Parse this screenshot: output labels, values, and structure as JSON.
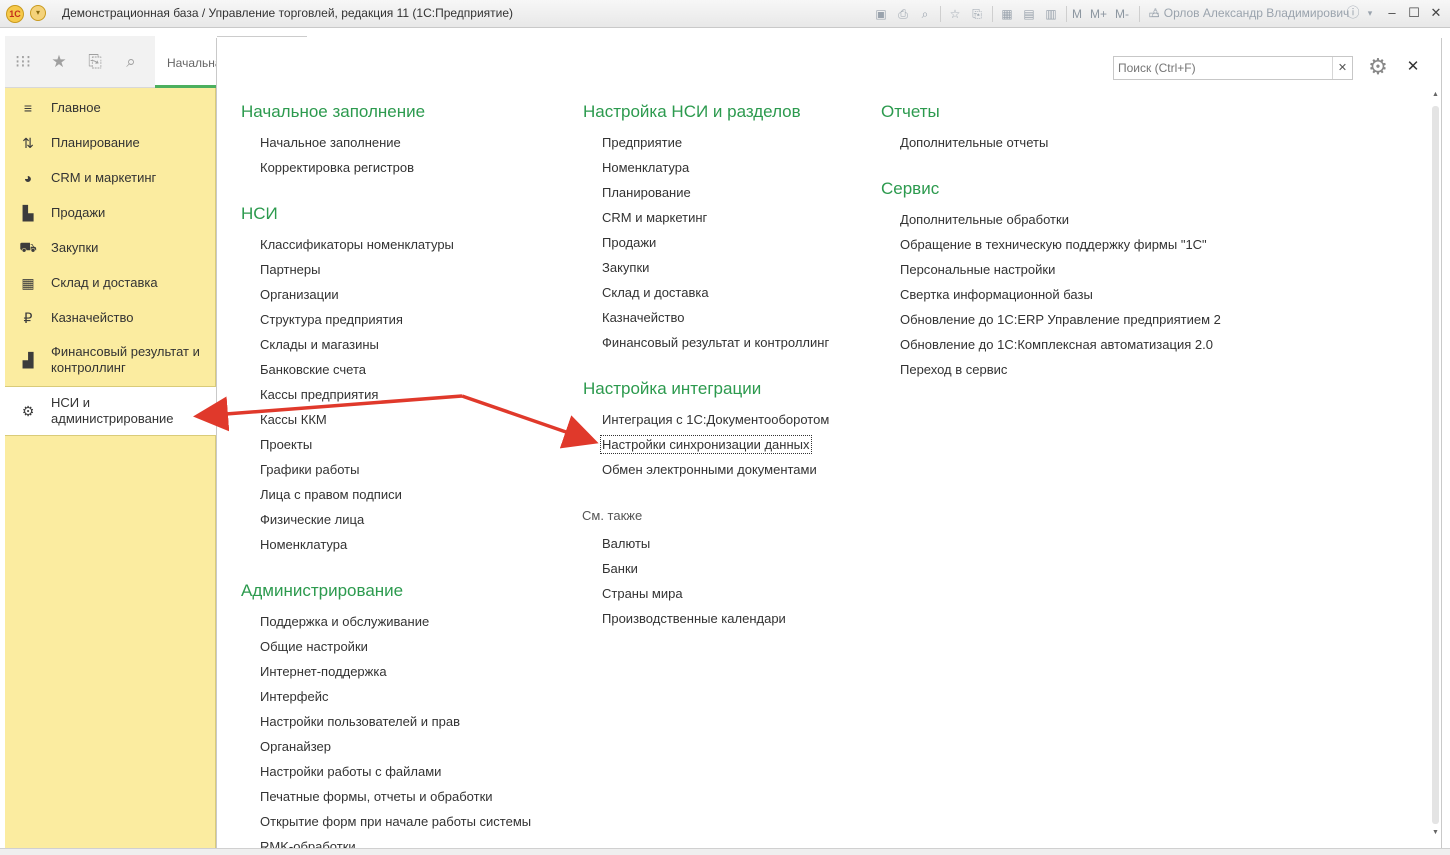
{
  "window": {
    "title": "Демонстрационная база / Управление торговлей, редакция 11  (1С:Предприятие)",
    "logo_text": "1С",
    "user": "Орлов Александр Владимирович",
    "toolbar_m": "M",
    "toolbar_mplus": "M+",
    "toolbar_mminus": "M-"
  },
  "tabs": {
    "start": "Начальная страница"
  },
  "sidebar": {
    "items": [
      {
        "label": "Главное",
        "icon": "menu-icon"
      },
      {
        "label": "Планирование",
        "icon": "planning-icon"
      },
      {
        "label": "CRM и маркетинг",
        "icon": "pie-chart-icon"
      },
      {
        "label": "Продажи",
        "icon": "shopping-bag-icon"
      },
      {
        "label": "Закупки",
        "icon": "cart-icon"
      },
      {
        "label": "Склад и доставка",
        "icon": "warehouse-icon"
      },
      {
        "label": "Казначейство",
        "icon": "ruble-icon"
      },
      {
        "label": "Финансовый результат и контроллинг",
        "icon": "bar-chart-icon"
      },
      {
        "label": "НСИ и администрирование",
        "icon": "gear-icon"
      }
    ]
  },
  "search": {
    "placeholder": "Поиск (Ctrl+F)"
  },
  "col1": {
    "groups": [
      {
        "title": "Начальное заполнение",
        "links": [
          "Начальное заполнение",
          "Корректировка регистров"
        ]
      },
      {
        "title": "НСИ",
        "links": [
          "Классификаторы номенклатуры",
          "Партнеры",
          "Организации",
          "Структура предприятия",
          "Склады и магазины",
          "Банковские счета",
          "Кассы предприятия",
          "Кассы ККМ",
          "Проекты",
          "Графики работы",
          "Лица с правом подписи",
          "Физические лица",
          "Номенклатура"
        ]
      },
      {
        "title": "Администрирование",
        "links": [
          "Поддержка и обслуживание",
          "Общие настройки",
          "Интернет-поддержка",
          "Интерфейс",
          "Настройки пользователей и прав",
          "Органайзер",
          "Настройки работы с файлами",
          "Печатные формы, отчеты и обработки",
          "Открытие форм при начале работы системы",
          "RMK-обработки"
        ]
      }
    ]
  },
  "col2": {
    "groups": [
      {
        "title": "Настройка НСИ и разделов",
        "links": [
          "Предприятие",
          "Номенклатура",
          "Планирование",
          "CRM и маркетинг",
          "Продажи",
          "Закупки",
          "Склад и доставка",
          "Казначейство",
          "Финансовый результат и контроллинг"
        ]
      },
      {
        "title": "Настройка интеграции",
        "links": [
          "Интеграция с 1С:Документооборотом",
          "Настройки синхронизации данных",
          "Обмен электронными документами"
        ]
      }
    ],
    "see_also": {
      "title": "См. также",
      "links": [
        "Валюты",
        "Банки",
        "Страны мира",
        "Производственные календари"
      ]
    }
  },
  "col3": {
    "groups": [
      {
        "title": "Отчеты",
        "links": [
          "Дополнительные отчеты"
        ]
      },
      {
        "title": "Сервис",
        "links": [
          "Дополнительные обработки",
          "Обращение в техническую поддержку фирмы \"1С\"",
          "Персональные настройки",
          "Свертка информационной базы",
          "Обновление до 1С:ERP Управление предприятием 2",
          "Обновление до 1С:Комплексная автоматизация 2.0",
          "Переход в сервис"
        ]
      }
    ]
  },
  "colors": {
    "accent_green": "#2c9a4e",
    "sidebar_bg": "#fbeca0",
    "arrow_red": "#e0392b"
  }
}
